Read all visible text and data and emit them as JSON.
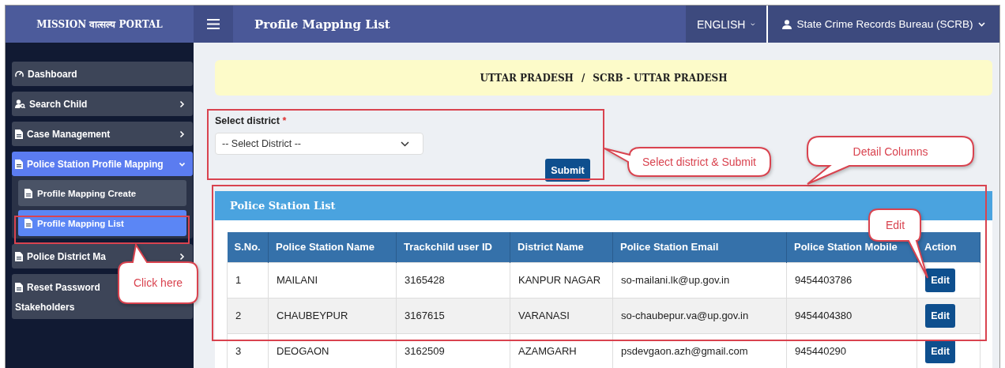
{
  "header": {
    "logo": "MISSION वात्सल्य PORTAL",
    "title": "Profile Mapping List",
    "language": "ENGLISH",
    "user": "State Crime Records Bureau (SCRB)"
  },
  "sidebar": {
    "items": [
      {
        "kind": "link",
        "label_lines": [
          "Dashboard"
        ],
        "selected": false
      },
      {
        "kind": "group",
        "label_lines": [
          "Search Child"
        ],
        "selected": false,
        "expanded": false
      },
      {
        "kind": "group",
        "label_lines": [
          "Case Management"
        ],
        "selected": false,
        "expanded": false
      },
      {
        "kind": "group",
        "label_lines": [
          "Police Station Profile Mapping"
        ],
        "selected": true,
        "expanded": true,
        "children": [
          {
            "label": "Profile Mapping Create",
            "selected": false
          },
          {
            "label": "Profile Mapping List",
            "selected": true
          }
        ]
      },
      {
        "kind": "group",
        "label_lines": [
          "Police District Ma"
        ],
        "selected": false,
        "expanded": false
      },
      {
        "kind": "link",
        "label_lines": [
          "Reset Password",
          "Stakeholders"
        ],
        "selected": false
      }
    ]
  },
  "breadcrumb": {
    "items": [
      "UTTAR PRADESH",
      "SCRB - UTTAR PRADESH"
    ],
    "separator": "/"
  },
  "form": {
    "label": "Select district",
    "required_mark": "*",
    "select_value": "-- Select District --",
    "submit": "Submit"
  },
  "table": {
    "title": "Police Station List",
    "columns": [
      "S.No.",
      "Police Station Name",
      "Trackchild user ID",
      "District Name",
      "Police Station Email",
      "Police Station Mobile",
      "Action"
    ],
    "rows": [
      {
        "cells": [
          "1",
          "MAILANI",
          "3165428",
          "KANPUR NAGAR",
          "so-mailani.lk@up.gov.in",
          "9454403786"
        ],
        "action": "Edit"
      },
      {
        "cells": [
          "2",
          "CHAUBEYPUR",
          "3167615",
          "VARANASI",
          "so-chaubepur.va@up.gov.in",
          "9454404380"
        ],
        "action": "Edit"
      },
      {
        "cells": [
          "3",
          "DEOGAON",
          "3162509",
          "AZAMGARH",
          "psdevgaon.azh@gmail.com",
          "945440290"
        ],
        "action": "Edit"
      }
    ]
  },
  "callouts": [
    "Select district & Submit",
    "Detail Columns",
    "Edit",
    "Click here"
  ]
}
